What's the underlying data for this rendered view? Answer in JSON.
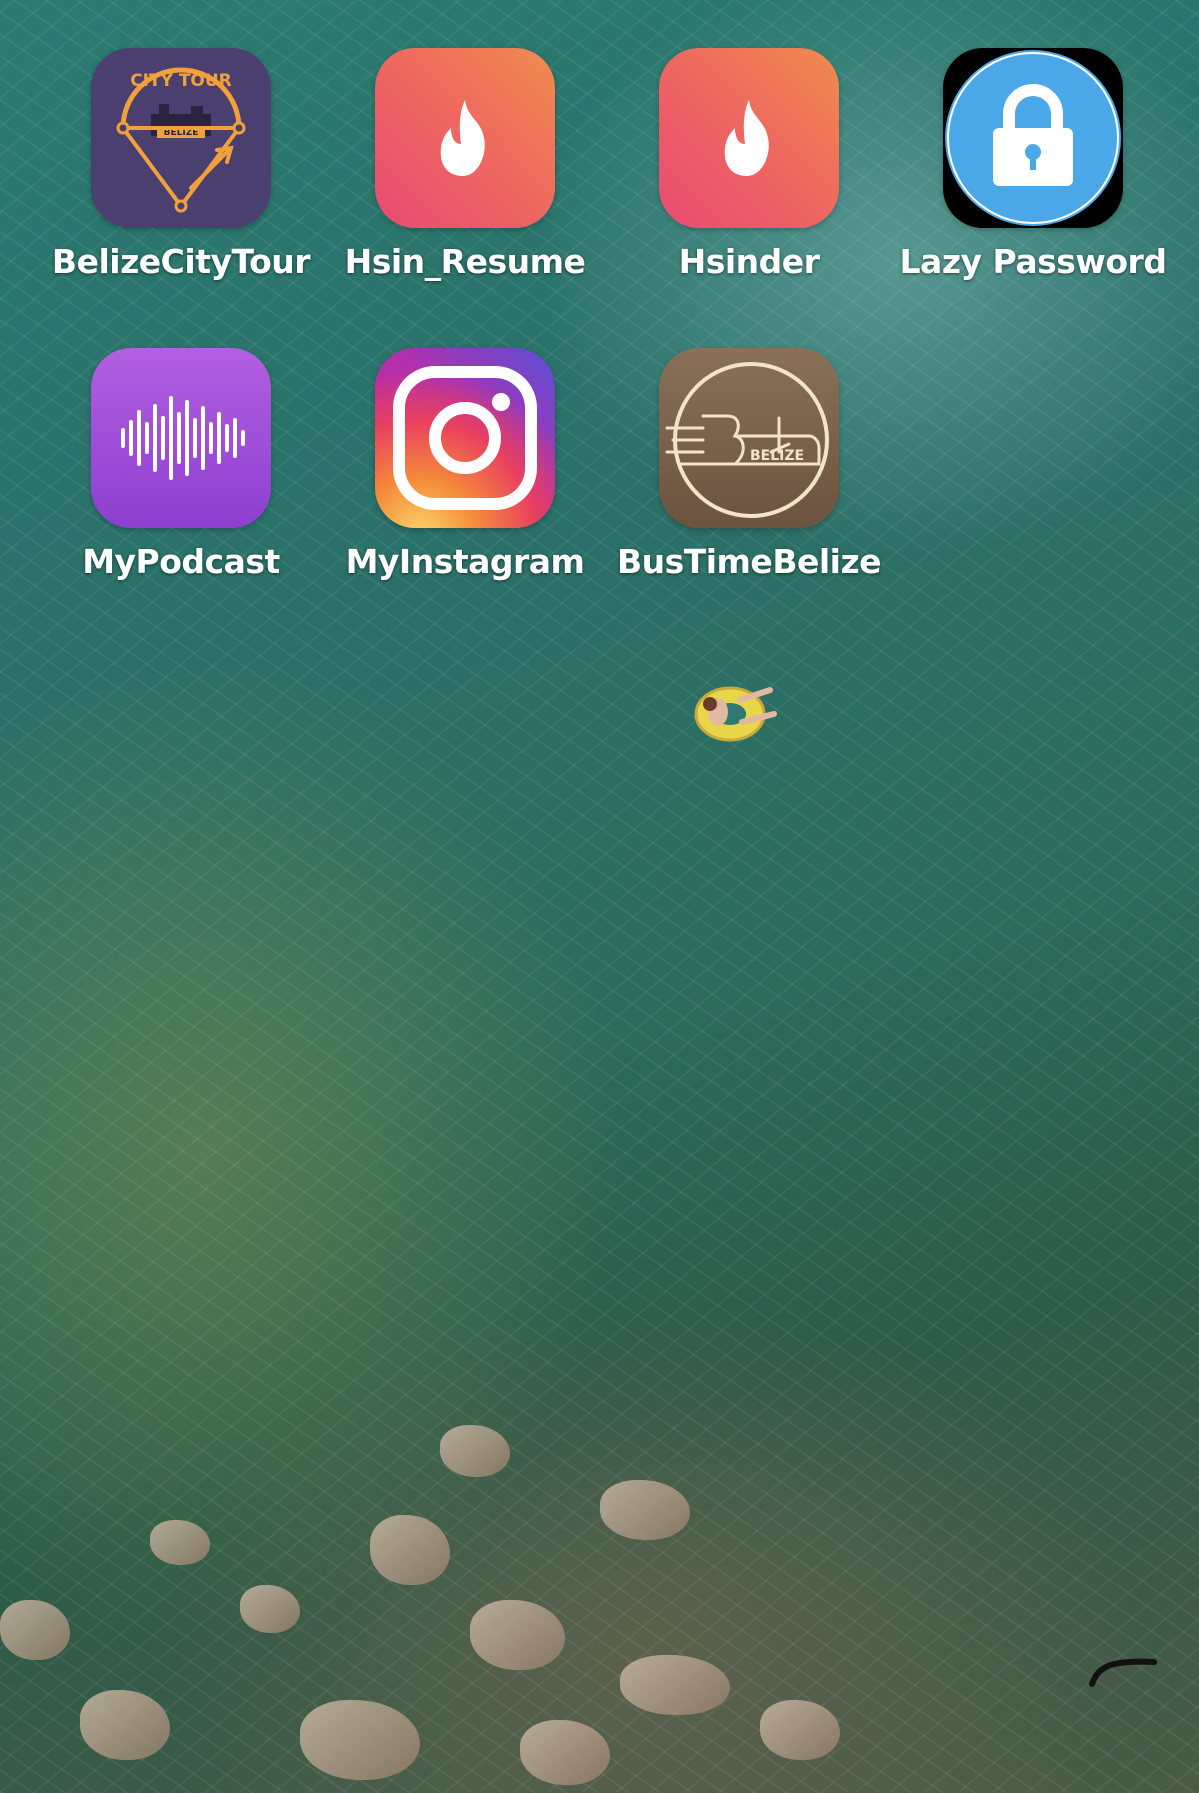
{
  "screen": {
    "type": "home-screen"
  },
  "apps": [
    {
      "label": "BelizeCityTour",
      "icon": "city-tour-belize-icon",
      "icon_text_top": "CITY TOUR",
      "icon_text_badge": "BELIZE"
    },
    {
      "label": "Hsin_Resume",
      "icon": "flame-icon"
    },
    {
      "label": "Hsinder",
      "icon": "flame-icon"
    },
    {
      "label": "Lazy Password",
      "icon": "padlock-icon"
    },
    {
      "label": "MyPodcast",
      "icon": "soundwave-icon"
    },
    {
      "label": "MyInstagram",
      "icon": "camera-icon"
    },
    {
      "label": "BusTimeBelize",
      "icon": "bus-icon",
      "icon_text": "BELIZE"
    }
  ],
  "colors": {
    "tinder_start": "#e94a74",
    "tinder_end": "#f18c4e",
    "lock_blue": "#4aa8e8",
    "podcast_purple": "#9a49d8",
    "belize_purple": "#4a3f6e",
    "belize_orange": "#f0a13a",
    "bus_brown": "#7a614b",
    "bus_cream": "#f3e4c8"
  }
}
